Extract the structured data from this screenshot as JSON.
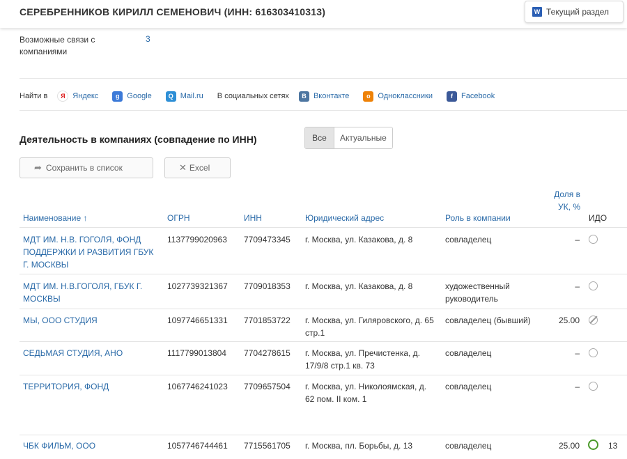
{
  "header": {
    "title": "СЕРЕБРЕННИКОВ КИРИЛЛ СЕМЕНОВИЧ (ИНН: 616303410313)",
    "section_button": "Текущий раздел",
    "section_icon": "word-icon"
  },
  "links": {
    "label": "Возможные связи с компаниями",
    "value": "3"
  },
  "search": {
    "find_label": "Найти в",
    "social_label": "В социальных сетях",
    "engines": [
      {
        "label": "Яндекс",
        "icon": "yandex-icon",
        "glyph": "Я"
      },
      {
        "label": "Google",
        "icon": "google-icon",
        "glyph": "g"
      },
      {
        "label": "Mail.ru",
        "icon": "mailru-icon",
        "glyph": "Q"
      }
    ],
    "socials": [
      {
        "label": "Вконтакте",
        "icon": "vk-icon",
        "glyph": "B"
      },
      {
        "label": "Одноклассники",
        "icon": "odnoklassniki-icon",
        "glyph": "o"
      },
      {
        "label": "Facebook",
        "icon": "facebook-icon",
        "glyph": "f"
      }
    ]
  },
  "activity": {
    "title": "Деятельность в компаниях (совпадение по ИНН)",
    "toggle": {
      "all": "Все",
      "current": "Актуальные",
      "selected": "Все"
    },
    "save_button": "Сохранить в список",
    "excel_button": "Excel"
  },
  "table": {
    "columns": {
      "name": "Наименование ↑",
      "ogrn": "ОГРН",
      "inn": "ИНН",
      "address": "Юридический адрес",
      "role": "Роль в компании",
      "share": "Доля в УК, %",
      "ido": "ИДО"
    },
    "rows": [
      {
        "name": "МДТ ИМ. Н.В. ГОГОЛЯ, ФОНД ПОДДЕРЖКИ И РАЗВИТИЯ ГБУК Г. МОСКВЫ",
        "ogrn": "1137799020963",
        "inn": "7709473345",
        "address": "г. Москва, ул. Казакова, д. 8",
        "role": "совладелец",
        "share": "–",
        "ido": "grey",
        "count": ""
      },
      {
        "name": "МДТ ИМ. Н.В.ГОГОЛЯ, ГБУК Г. МОСКВЫ",
        "ogrn": "1027739321367",
        "inn": "7709018353",
        "address": "г. Москва, ул. Казакова, д. 8",
        "role": "художественный руководитель",
        "share": "–",
        "ido": "grey",
        "count": ""
      },
      {
        "name": "МЫ, ООО СТУДИЯ",
        "ogrn": "1097746651331",
        "inn": "7701853722",
        "address": "г. Москва, ул. Гиляровского, д. 65 стр.1",
        "role": "совладелец (бывший)",
        "share": "25.00",
        "ido": "slash",
        "count": ""
      },
      {
        "name": "СЕДЬМАЯ СТУДИЯ, АНО",
        "ogrn": "1117799013804",
        "inn": "7704278615",
        "address": "г. Москва, ул. Пречистенка, д. 17/9/8 стр.1 кв. 73",
        "role": "совладелец",
        "share": "–",
        "ido": "grey",
        "count": ""
      },
      {
        "name": "ТЕРРИТОРИЯ, ФОНД",
        "ogrn": "1067746241023",
        "inn": "7709657504",
        "address": "г. Москва, ул. Николоямская, д. 62 пом. II ком. 1",
        "role": "совладелец",
        "share": "–",
        "ido": "grey",
        "count": ""
      },
      {
        "name": "ЧБК ФИЛЬМ, ООО",
        "ogrn": "1057746744461",
        "inn": "7715561705",
        "address": "г. Москва, пл. Борьбы, д. 13",
        "role": "совладелец",
        "share": "25.00",
        "ido": "green",
        "count": "13"
      }
    ]
  }
}
